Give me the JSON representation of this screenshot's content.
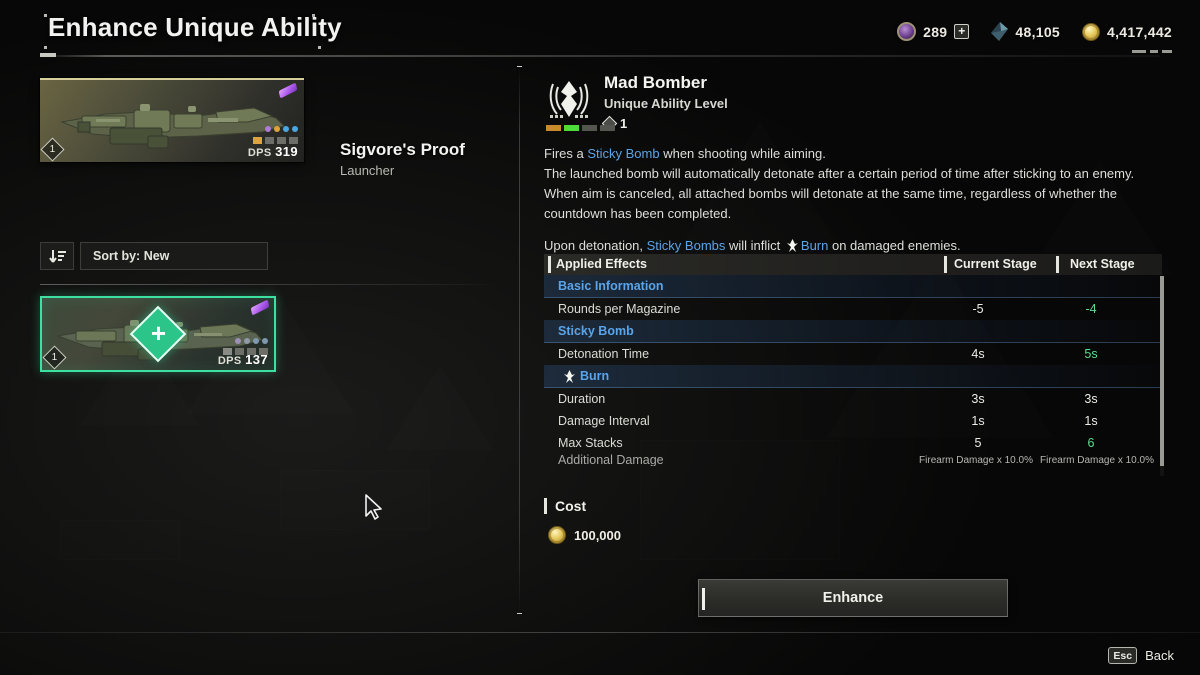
{
  "header": {
    "title": "Enhance Unique Ability",
    "currencies": [
      {
        "icon": "gem-icon",
        "value": "289",
        "has_plus": true,
        "plus_label": "+"
      },
      {
        "icon": "shard-icon",
        "value": "48,105",
        "has_plus": false
      },
      {
        "icon": "coin-icon",
        "value": "4,417,442",
        "has_plus": false
      }
    ]
  },
  "left_panel": {
    "equipped": {
      "name": "Sigvore's Proof",
      "type": "Launcher",
      "rank": "1",
      "dps_label": "DPS",
      "dps_value": "319",
      "rarity_color": "#a855e8",
      "dot_colors": [
        "#b07ad8",
        "#e0a23c",
        "#4aa8e0",
        "#4aa8e0"
      ],
      "bar_colors": [
        "#e0a23c",
        "#6e6e68",
        "#6e6e68",
        "#6e6e68"
      ]
    },
    "sort": {
      "icon": "sort-descending-icon",
      "label": "Sort by: New"
    },
    "items": [
      {
        "selected": true,
        "rank": "1",
        "dps_label": "DPS",
        "dps_value": "137",
        "badge": "plus-diamond-icon",
        "rarity_color": "#a855e8",
        "dot_colors": [
          "#b07ad8",
          "#e0a23c",
          "#4aa8e0",
          "#4aa8e0"
        ],
        "bar_colors": [
          "#8a8a84",
          "#6e6e68",
          "#6e6e68",
          "#6e6e68"
        ]
      }
    ]
  },
  "ability": {
    "emblem": "winged-crest-icon",
    "name": "Mad Bomber",
    "subtitle": "Unique Ability Level",
    "level": "1",
    "level_bars": [
      "#c98c28",
      "#4ddc3a",
      "#55554f",
      "#55554f"
    ],
    "description": {
      "line1_a": "Fires a ",
      "line1_kw": "Sticky Bomb",
      "line1_b": " when shooting while aiming.",
      "line2": "The launched bomb will automatically detonate after a certain period of time after sticking to an enemy.",
      "line3": "When aim is canceled, all attached bombs will detonate at the same time, regardless of whether the",
      "line4": "countdown has been completed.",
      "line5_a": "Upon detonation, ",
      "line5_kw1": "Sticky Bombs",
      "line5_b": " will inflict ",
      "line5_kw2": "Burn",
      "line5_c": " on damaged enemies."
    }
  },
  "table": {
    "headers": {
      "effects": "Applied Effects",
      "current": "Current Stage",
      "next": "Next Stage"
    },
    "rows": [
      {
        "kind": "section",
        "label": "Basic Information",
        "indent": false
      },
      {
        "kind": "data",
        "label": "Rounds per Magazine",
        "current": "-5",
        "next": "-4",
        "improved": true
      },
      {
        "kind": "section",
        "label": "Sticky Bomb",
        "indent": false
      },
      {
        "kind": "data",
        "label": "Detonation Time",
        "current": "4s",
        "next": "5s",
        "improved": true
      },
      {
        "kind": "section",
        "label": "Burn",
        "indent": true,
        "icon": "burn-icon"
      },
      {
        "kind": "data",
        "label": "Duration",
        "current": "3s",
        "next": "3s",
        "improved": false
      },
      {
        "kind": "data",
        "label": "Damage Interval",
        "current": "1s",
        "next": "1s",
        "improved": false
      },
      {
        "kind": "data",
        "label": "Max Stacks",
        "current": "5",
        "next": "6",
        "improved": true
      },
      {
        "kind": "data",
        "label": "Additional Damage",
        "current": "Firearm Damage x 10.0%",
        "next": "Firearm Damage x 10.0%",
        "improved": false,
        "clipped": true,
        "small": true
      }
    ]
  },
  "cost": {
    "title": "Cost",
    "icon": "coin-icon",
    "amount": "100,000"
  },
  "action": {
    "enhance_label": "Enhance"
  },
  "footer": {
    "key": "Esc",
    "label": "Back"
  },
  "colors": {
    "accent_green": "#5ddc8f",
    "accent_blue": "#5ba4e8",
    "select_border": "#3ce0a0",
    "gold": "#e6c95c"
  }
}
